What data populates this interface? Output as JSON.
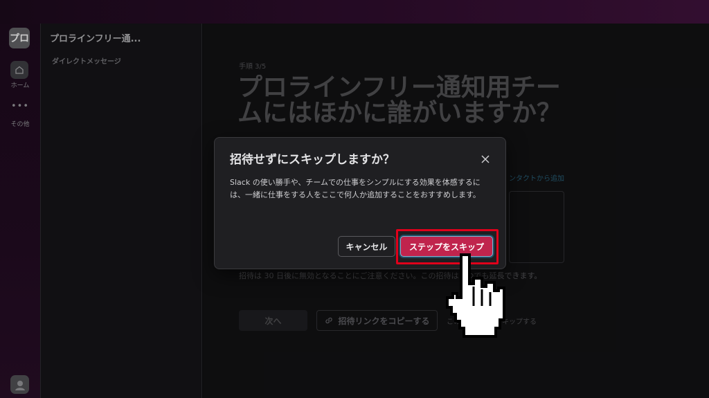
{
  "rail": {
    "workspace_initials": "プロ",
    "home_label": "ホーム",
    "more_glyph": "•••",
    "more_label": "その他"
  },
  "sidebar": {
    "workspace_name": "プロラインフリー通...",
    "dm_label": "ダイレクトメッセージ"
  },
  "main": {
    "step": "手順 3/5",
    "heading": "プロラインフリー通知用チームにはほかに誰がいますか？",
    "add_from_contacts": "ンタクトから追加",
    "note": "招待は 30 日後に無効となることにご注意ください。この招待はいつでも延長できます。",
    "next_label": "次へ",
    "copy_link_label": "招待リンクをコピーする",
    "skip_step_link": "このステップをスキップする"
  },
  "dialog": {
    "title": "招待せずにスキップしますか？",
    "body": "Slack の使い勝手や、チームでの仕事をシンプルにする効果を体感するには、一緒に仕事をする人をここで何人か追加することをおすすめします。",
    "cancel_label": "キャンセル",
    "skip_label": "ステップをスキップ"
  },
  "colors": {
    "accent": "#c0244d",
    "highlight": "#e0001b"
  },
  "icons": [
    "home-icon",
    "more-icon",
    "close-icon",
    "link-icon",
    "pointer-hand-icon",
    "user-avatar-icon"
  ]
}
